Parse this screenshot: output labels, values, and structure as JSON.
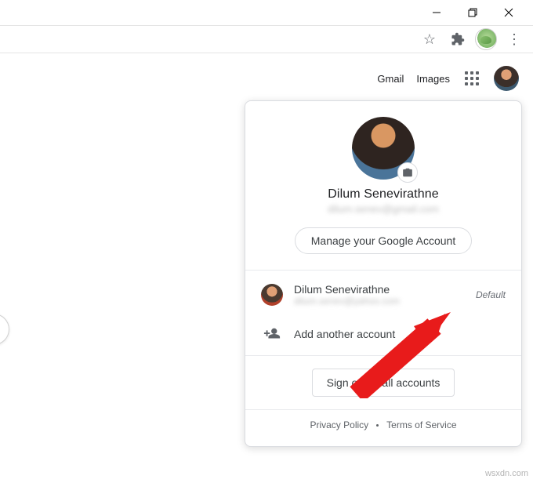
{
  "ghead": {
    "gmail": "Gmail",
    "images": "Images"
  },
  "panel": {
    "name": "Dilum Senevirathne",
    "email": "dilum.senev@gmail.com",
    "manage": "Manage your Google Account",
    "accounts": [
      {
        "name": "Dilum Senevirathne",
        "email": "dilum.senev@yahoo.com",
        "tag": "Default"
      }
    ],
    "add": "Add another account",
    "signout": "Sign out of all accounts",
    "privacy": "Privacy Policy",
    "terms": "Terms of Service"
  },
  "watermark": "wsxdn.com"
}
